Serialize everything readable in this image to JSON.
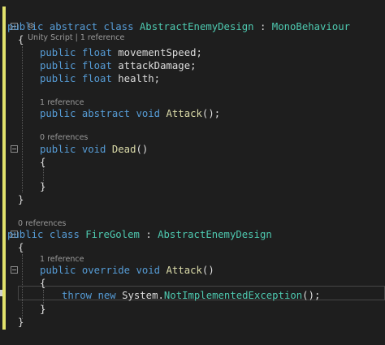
{
  "colors": {
    "background": "#1e1e1e",
    "keyword": "#569cd6",
    "type": "#4ec9b0",
    "method": "#dcdcaa",
    "text": "#dcdcdc",
    "codelens": "#9a9a9a",
    "change_margin": "#e2e26c"
  },
  "icons": {
    "codelens_unity": "unity-gear-icon"
  },
  "codelens": {
    "class1": "Unity Script | 1 reference",
    "attack1": "1 reference",
    "dead": "0 references",
    "class2": "0 references",
    "attack2": "1 reference"
  },
  "code": {
    "l1": {
      "a": "public",
      "b": "abstract",
      "c": "class",
      "d": "AbstractEnemyDesign",
      "e": ":",
      "f": "MonoBehaviour"
    },
    "brace_open": "{",
    "brace_close": "}",
    "field1": {
      "a": "public",
      "b": "float",
      "c": "movementSpeed;"
    },
    "field2": {
      "a": "public",
      "b": "float",
      "c": "attackDamage;"
    },
    "field3": {
      "a": "public",
      "b": "float",
      "c": "health;"
    },
    "attack1": {
      "a": "public",
      "b": "abstract",
      "c": "void",
      "d": "Attack",
      "e": "();"
    },
    "dead": {
      "a": "public",
      "b": "void",
      "c": "Dead",
      "d": "()"
    },
    "l2": {
      "a": "public",
      "b": "class",
      "c": "FireGolem",
      "d": ":",
      "e": "AbstractEnemyDesign"
    },
    "attack2": {
      "a": "public",
      "b": "override",
      "c": "void",
      "d": "Attack",
      "e": "()"
    },
    "throw": {
      "a": "throw",
      "b": "new",
      "c": "System.",
      "d": "NotImplementedException",
      "e": "();"
    }
  }
}
